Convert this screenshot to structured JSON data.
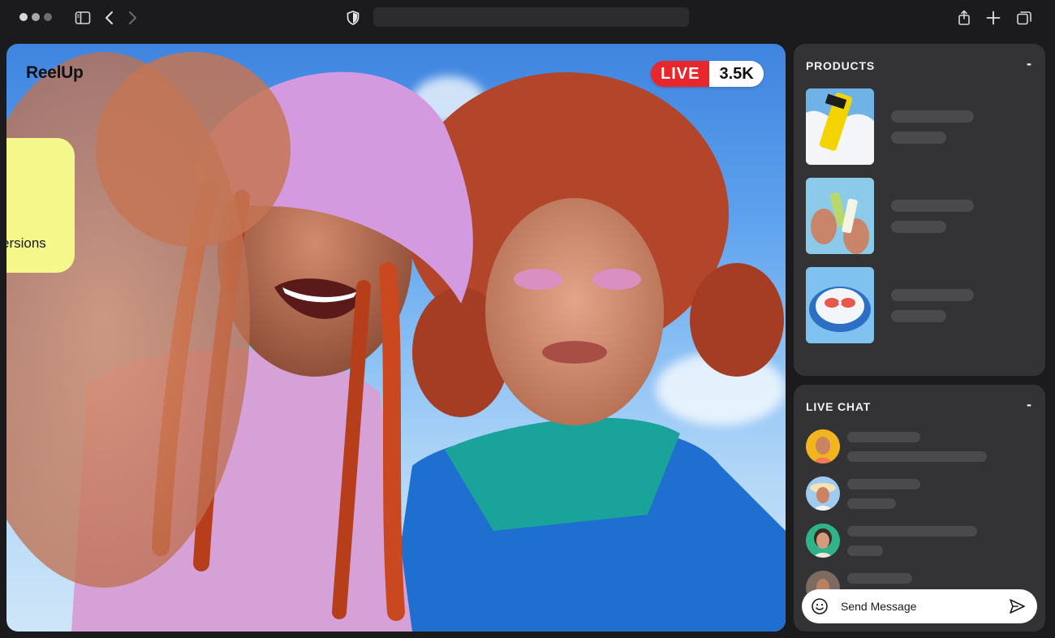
{
  "browser": {
    "icons": [
      "sidebar-icon",
      "back-icon",
      "forward-icon",
      "shield-icon",
      "share-icon",
      "plus-icon",
      "tabs-icon"
    ],
    "url": ""
  },
  "video": {
    "brand": "ReelUp",
    "live_label": "LIVE",
    "viewer_count": "3.5K",
    "card_text": "ersions",
    "colors": {
      "live_red": "#e8272c",
      "card_yellow": "#f4f78a"
    }
  },
  "products": {
    "title": "PRODUCTS",
    "collapse_label": "-",
    "items": [
      {
        "thumb": "sunscreen-tube"
      },
      {
        "thumb": "hands-holding-bottles"
      },
      {
        "thumb": "sunglasses-on-pool"
      }
    ]
  },
  "chat": {
    "title": "LIVE CHAT",
    "collapse_label": "-",
    "messages": [
      {
        "avatar": "avatar-yellow"
      },
      {
        "avatar": "avatar-sky"
      },
      {
        "avatar": "avatar-green"
      },
      {
        "avatar": "avatar-partial"
      }
    ],
    "input_placeholder": "Send Message"
  }
}
